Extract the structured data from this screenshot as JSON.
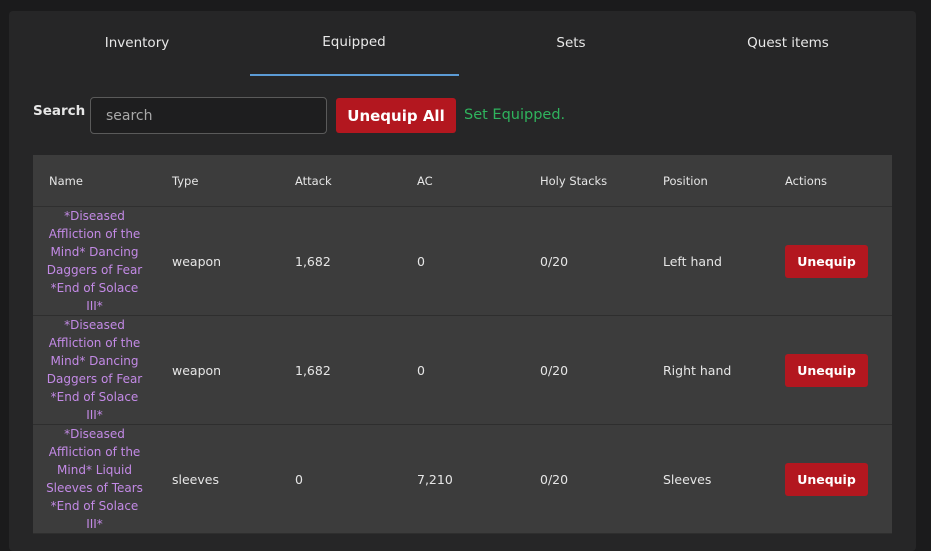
{
  "tabs": [
    {
      "label": "Inventory"
    },
    {
      "label": "Equipped"
    },
    {
      "label": "Sets"
    },
    {
      "label": "Quest items"
    }
  ],
  "active_tab": "Equipped",
  "search": {
    "label": "Search",
    "placeholder": "search",
    "value": ""
  },
  "toolbar": {
    "unequip_all_label": "Unequip All",
    "status_message": "Set Equipped."
  },
  "table": {
    "headers": [
      "Name",
      "Type",
      "Attack",
      "AC",
      "Holy Stacks",
      "Position",
      "Actions"
    ],
    "rows": [
      {
        "name": "*Diseased Affliction of the Mind* Dancing Daggers of Fear *End of Solace III*",
        "type": "weapon",
        "attack": "1,682",
        "ac": "0",
        "holy": "0/20",
        "position": "Left hand",
        "action": "Unequip"
      },
      {
        "name": "*Diseased Affliction of the Mind* Dancing Daggers of Fear *End of Solace III*",
        "type": "weapon",
        "attack": "1,682",
        "ac": "0",
        "holy": "0/20",
        "position": "Right hand",
        "action": "Unequip"
      },
      {
        "name": "*Diseased Affliction of the Mind* Liquid Sleeves of Tears *End of Solace III*",
        "type": "sleeves",
        "attack": "0",
        "ac": "7,210",
        "holy": "0/20",
        "position": "Sleeves",
        "action": "Unequip"
      }
    ]
  },
  "colors": {
    "accent_red": "#b3171f",
    "success_green": "#2fb35d",
    "item_name_purple": "#c38ae6",
    "tab_underline_blue": "#5b9bd5"
  }
}
